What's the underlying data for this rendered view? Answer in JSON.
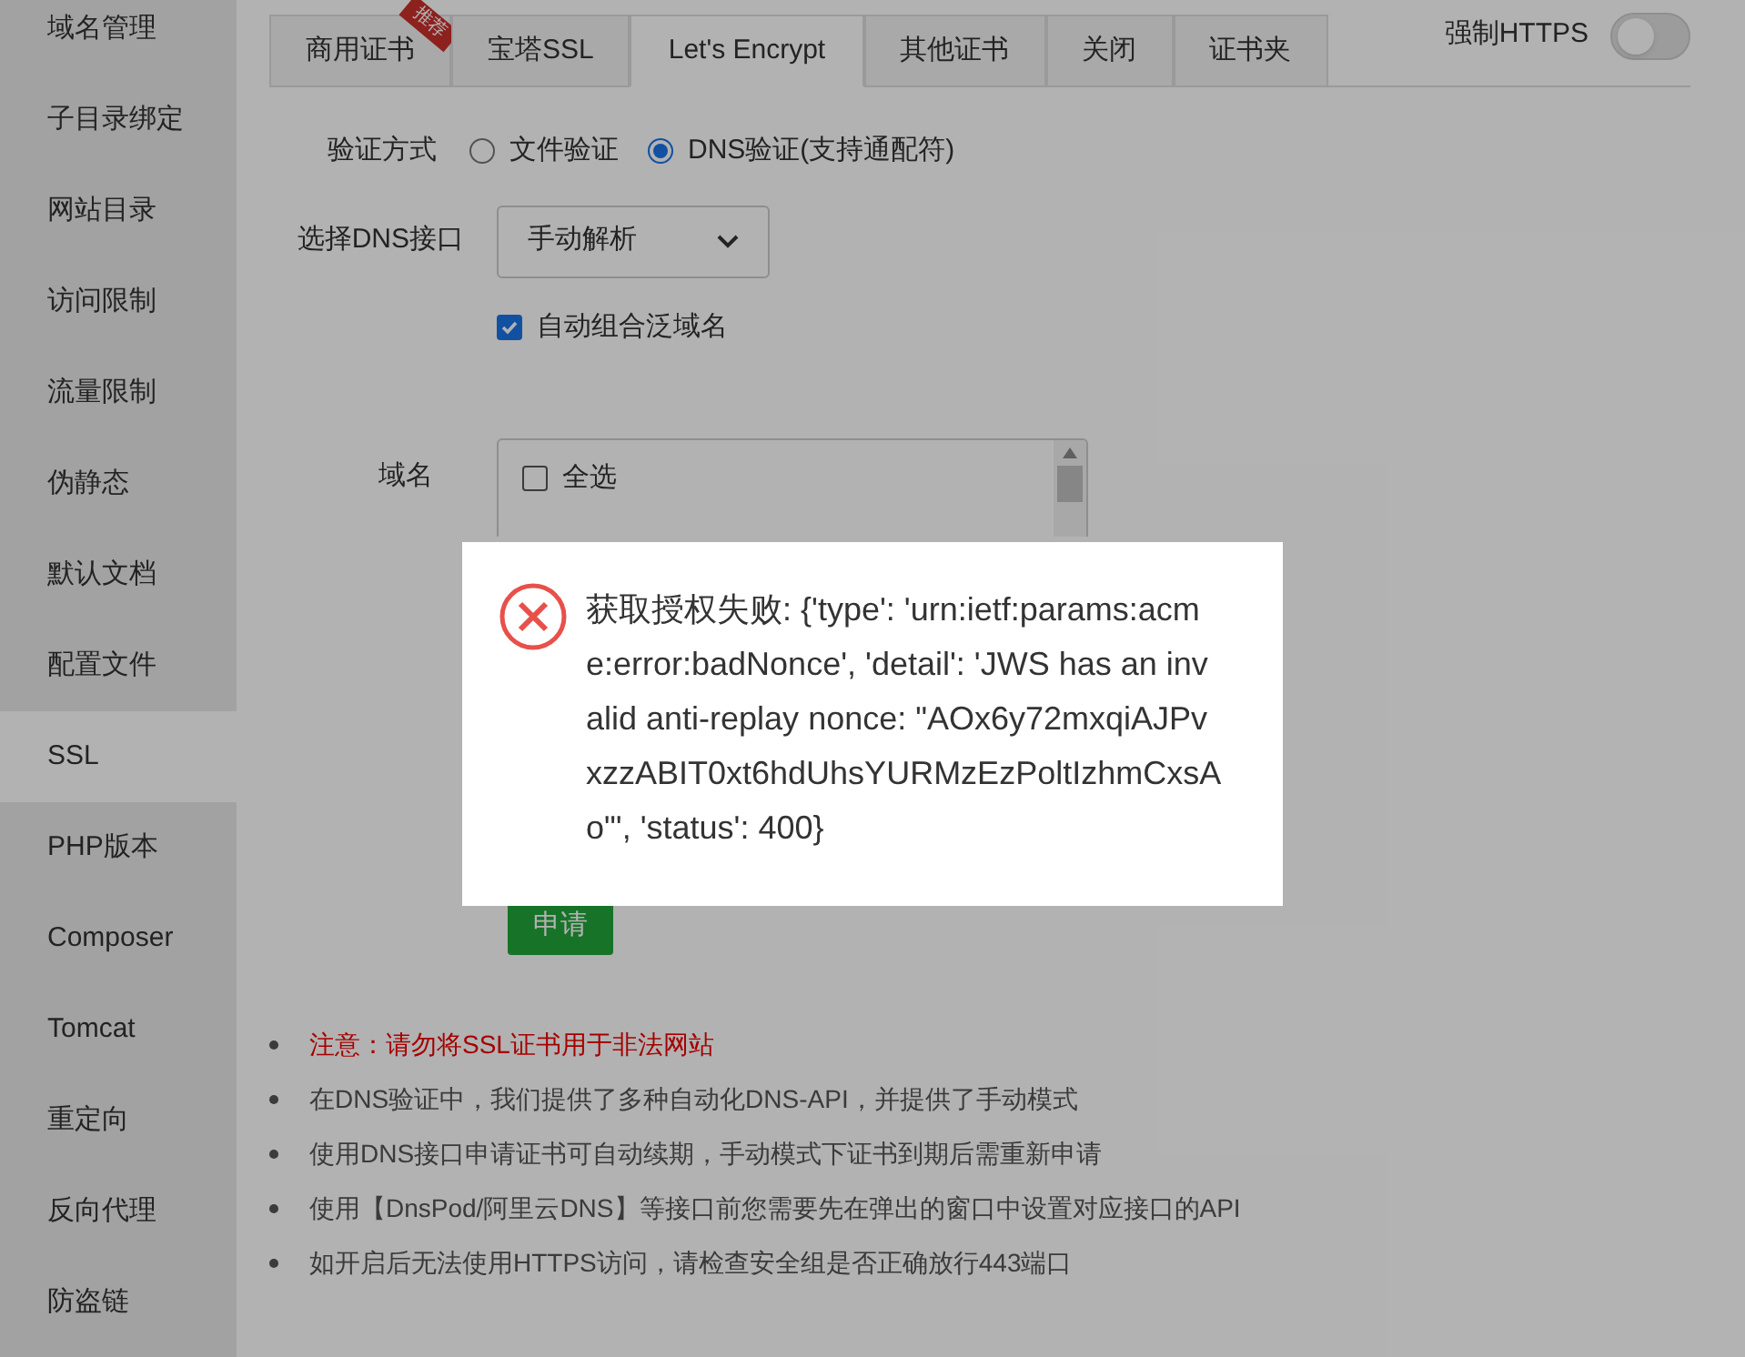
{
  "sidebar": {
    "items": [
      {
        "label": "域名管理",
        "selected": false
      },
      {
        "label": "子目录绑定",
        "selected": false
      },
      {
        "label": "网站目录",
        "selected": false
      },
      {
        "label": "访问限制",
        "selected": false
      },
      {
        "label": "流量限制",
        "selected": false
      },
      {
        "label": "伪静态",
        "selected": false
      },
      {
        "label": "默认文档",
        "selected": false
      },
      {
        "label": "配置文件",
        "selected": false
      },
      {
        "label": "SSL",
        "selected": true
      },
      {
        "label": "PHP版本",
        "selected": false
      },
      {
        "label": "Composer",
        "selected": false
      },
      {
        "label": "Tomcat",
        "selected": false
      },
      {
        "label": "重定向",
        "selected": false
      },
      {
        "label": "反向代理",
        "selected": false
      },
      {
        "label": "防盗链",
        "selected": false
      }
    ]
  },
  "tabs": [
    {
      "label": "商用证书",
      "selected": false,
      "badge": "推荐"
    },
    {
      "label": "宝塔SSL",
      "selected": false
    },
    {
      "label": "Let's Encrypt",
      "selected": true
    },
    {
      "label": "其他证书",
      "selected": false
    },
    {
      "label": "关闭",
      "selected": false
    },
    {
      "label": "证书夹",
      "selected": false
    }
  ],
  "force_https": {
    "label": "强制HTTPS",
    "on": false
  },
  "form": {
    "verify_label": "验证方式",
    "verify_options": [
      {
        "label": "文件验证",
        "selected": false
      },
      {
        "label": "DNS验证(支持通配符)",
        "selected": true
      }
    ],
    "dns_label": "选择DNS接口",
    "dns_value": "手动解析",
    "wildcard": {
      "label": "自动组合泛域名",
      "checked": true
    },
    "domain_label": "域名",
    "domains": [
      {
        "label": "全选",
        "checked": false
      }
    ],
    "submit": "申请"
  },
  "notes": [
    {
      "text": "注意：请勿将SSL证书用于非法网站",
      "kind": "warning"
    },
    {
      "text": "在DNS验证中，我们提供了多种自动化DNS-API，并提供了手动模式",
      "kind": "info"
    },
    {
      "text": "使用DNS接口申请证书可自动续期，手动模式下证书到期后需重新申请",
      "kind": "info"
    },
    {
      "text": "使用【DnsPod/阿里云DNS】等接口前您需要先在弹出的窗口中设置对应接口的API",
      "kind": "info"
    },
    {
      "text": "如开启后无法使用HTTPS访问，请检查安全组是否正确放行443端口",
      "kind": "info"
    }
  ],
  "dialog": {
    "message": "获取授权失败: {'type': 'urn:ietf:params:acme:error:badNonce', 'detail': 'JWS has an invalid anti-replay nonce: \"AOx6y72mxqiAJPvxzzABIT0xt6hdUhsYURMzEzPoltIzhmCxsAo\"', 'status': 400}"
  }
}
